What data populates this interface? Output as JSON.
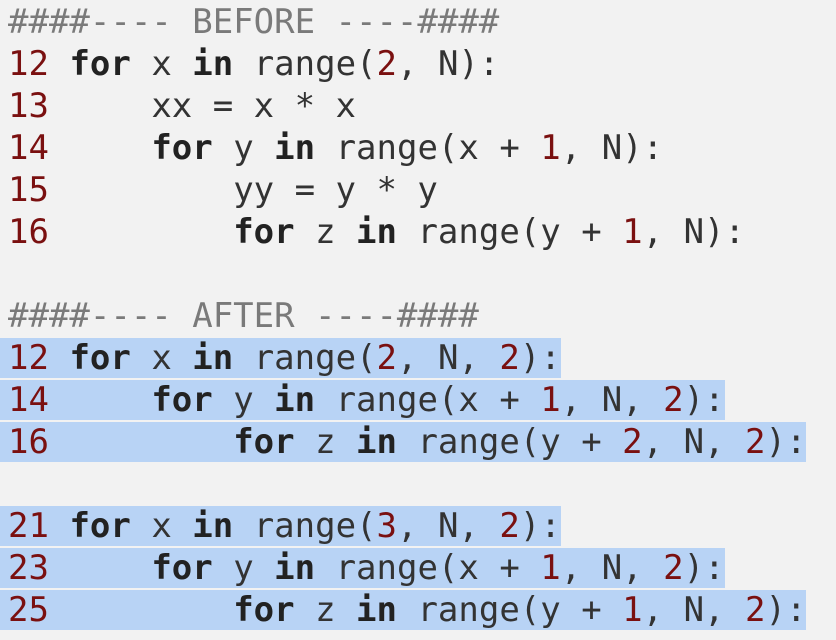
{
  "before_header": "####---- BEFORE ----####",
  "after_header": "####---- AFTER ----####",
  "before_lines": [
    {
      "ln": "12",
      "indent": " ",
      "parts": [
        [
          "kw",
          "for"
        ],
        [
          "t",
          " x "
        ],
        [
          "kw",
          "in"
        ],
        [
          "t",
          " range("
        ],
        [
          "num",
          "2"
        ],
        [
          "t",
          ", N):"
        ]
      ]
    },
    {
      "ln": "13",
      "indent": "     ",
      "parts": [
        [
          "t",
          "xx = x * x"
        ]
      ]
    },
    {
      "ln": "14",
      "indent": "     ",
      "parts": [
        [
          "kw",
          "for"
        ],
        [
          "t",
          " y "
        ],
        [
          "kw",
          "in"
        ],
        [
          "t",
          " range(x + "
        ],
        [
          "num",
          "1"
        ],
        [
          "t",
          ", N):"
        ]
      ]
    },
    {
      "ln": "15",
      "indent": "         ",
      "parts": [
        [
          "t",
          "yy = y * y"
        ]
      ]
    },
    {
      "ln": "16",
      "indent": "         ",
      "parts": [
        [
          "kw",
          "for"
        ],
        [
          "t",
          " z "
        ],
        [
          "kw",
          "in"
        ],
        [
          "t",
          " range(y + "
        ],
        [
          "num",
          "1"
        ],
        [
          "t",
          ", N):"
        ]
      ]
    }
  ],
  "after_block_1": [
    {
      "ln": "12",
      "indent": " ",
      "parts": [
        [
          "kw",
          "for"
        ],
        [
          "t",
          " x "
        ],
        [
          "kw",
          "in"
        ],
        [
          "t",
          " range("
        ],
        [
          "num",
          "2"
        ],
        [
          "t",
          ", N, "
        ],
        [
          "num",
          "2"
        ],
        [
          "t",
          "):"
        ]
      ]
    },
    {
      "ln": "14",
      "indent": "     ",
      "parts": [
        [
          "kw",
          "for"
        ],
        [
          "t",
          " y "
        ],
        [
          "kw",
          "in"
        ],
        [
          "t",
          " range(x + "
        ],
        [
          "num",
          "1"
        ],
        [
          "t",
          ", N, "
        ],
        [
          "num",
          "2"
        ],
        [
          "t",
          "):"
        ]
      ]
    },
    {
      "ln": "16",
      "indent": "         ",
      "parts": [
        [
          "kw",
          "for"
        ],
        [
          "t",
          " z "
        ],
        [
          "kw",
          "in"
        ],
        [
          "t",
          " range(y + "
        ],
        [
          "num",
          "2"
        ],
        [
          "t",
          ", N, "
        ],
        [
          "num",
          "2"
        ],
        [
          "t",
          "):"
        ]
      ]
    }
  ],
  "after_block_2": [
    {
      "ln": "21",
      "indent": " ",
      "parts": [
        [
          "kw",
          "for"
        ],
        [
          "t",
          " x "
        ],
        [
          "kw",
          "in"
        ],
        [
          "t",
          " range("
        ],
        [
          "num",
          "3"
        ],
        [
          "t",
          ", N, "
        ],
        [
          "num",
          "2"
        ],
        [
          "t",
          "):"
        ]
      ]
    },
    {
      "ln": "23",
      "indent": "     ",
      "parts": [
        [
          "kw",
          "for"
        ],
        [
          "t",
          " y "
        ],
        [
          "kw",
          "in"
        ],
        [
          "t",
          " range(x + "
        ],
        [
          "num",
          "1"
        ],
        [
          "t",
          ", N, "
        ],
        [
          "num",
          "2"
        ],
        [
          "t",
          "):"
        ]
      ]
    },
    {
      "ln": "25",
      "indent": "         ",
      "parts": [
        [
          "kw",
          "for"
        ],
        [
          "t",
          " z "
        ],
        [
          "kw",
          "in"
        ],
        [
          "t",
          " range(y + "
        ],
        [
          "num",
          "1"
        ],
        [
          "t",
          ", N, "
        ],
        [
          "num",
          "2"
        ],
        [
          "t",
          "):"
        ]
      ]
    }
  ]
}
